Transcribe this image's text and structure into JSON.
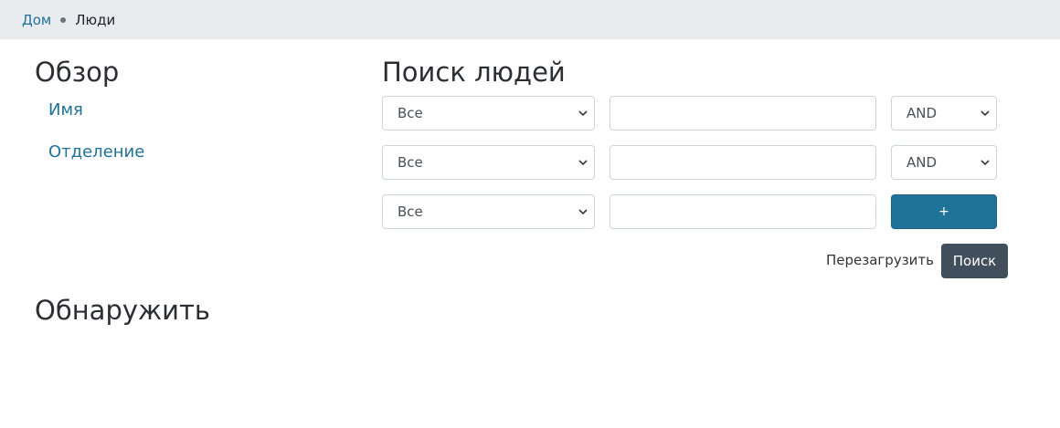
{
  "breadcrumb": {
    "home": "Дом",
    "current": "Люди"
  },
  "overview": {
    "title": "Обзор",
    "links": [
      "Имя",
      "Отделение"
    ]
  },
  "search": {
    "title": "Поиск людей",
    "rows": [
      {
        "field": "Все",
        "value": "",
        "operator": "AND"
      },
      {
        "field": "Все",
        "value": "",
        "operator": "AND"
      },
      {
        "field": "Все",
        "value": ""
      }
    ],
    "add_label": "+",
    "reset_label": "Перезагрузить",
    "search_label": "Поиск"
  },
  "discover": {
    "title": "Обнаружить"
  },
  "colors": {
    "link": "#1f7398",
    "primary": "#1f7398",
    "dark_button": "#414e5c",
    "breadcrumb_bg": "#e9ecef"
  },
  "icons": {
    "select_arrow": "chevron-down-icon",
    "breadcrumb_separator": "dot-icon"
  }
}
